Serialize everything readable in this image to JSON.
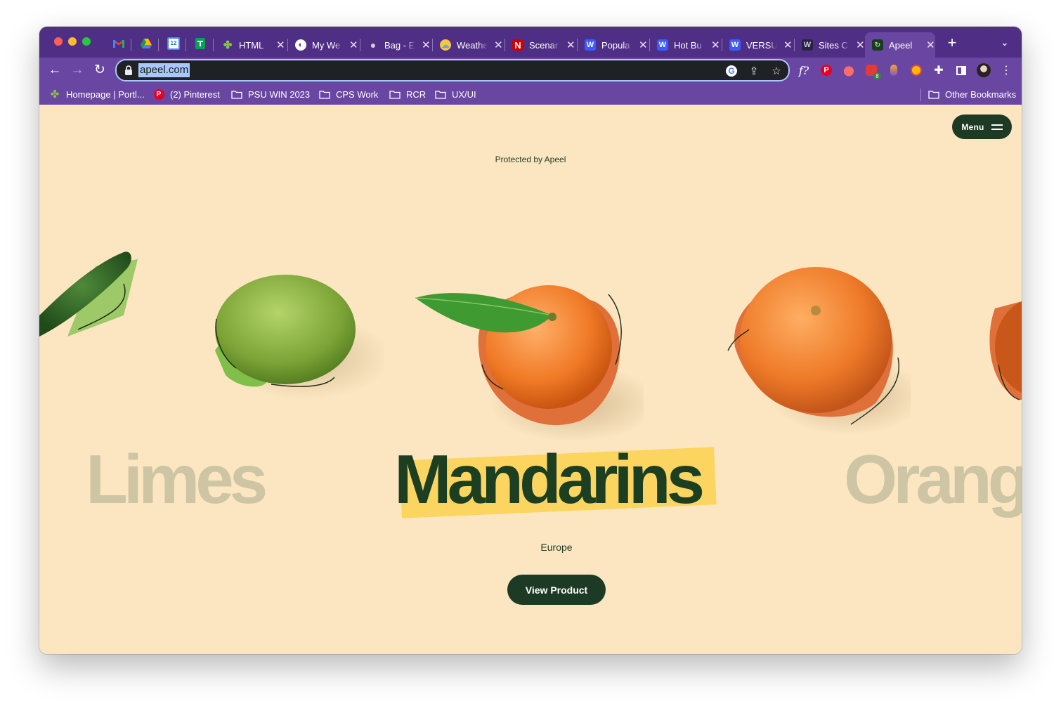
{
  "browser": {
    "tabs": [
      {
        "title": "HTML",
        "favicon": "figma-like-icon"
      },
      {
        "title": "My We",
        "favicon": "globe-icon"
      },
      {
        "title": "Bag - E",
        "favicon": "apple-icon"
      },
      {
        "title": "Weathe",
        "favicon": "weather-icon"
      },
      {
        "title": "Scenar",
        "favicon": "n-logo-icon"
      },
      {
        "title": "Popula",
        "favicon": "w-logo-icon"
      },
      {
        "title": "Hot Bu",
        "favicon": "w-logo-icon"
      },
      {
        "title": "VERSU",
        "favicon": "w-logo-icon"
      },
      {
        "title": "Sites C",
        "favicon": "w-dark-logo-icon"
      },
      {
        "title": "Apeel",
        "favicon": "apeel-icon",
        "active": true
      }
    ],
    "pinned": [
      "gmail-icon",
      "drive-icon",
      "calendar-icon",
      "sheets-icon"
    ],
    "address": "apeel.com",
    "bookmarks": [
      {
        "label": "Homepage | Portl...",
        "icon": "clover-icon"
      },
      {
        "label": "(2) Pinterest",
        "icon": "pinterest-icon"
      },
      {
        "label": "PSU WIN 2023",
        "icon": "folder-icon"
      },
      {
        "label": "CPS Work",
        "icon": "folder-icon"
      },
      {
        "label": "RCR",
        "icon": "folder-icon"
      },
      {
        "label": "UX/UI",
        "icon": "folder-icon"
      }
    ],
    "other_bookmarks": "Other Bookmarks",
    "badge_count": "8"
  },
  "page": {
    "menu_label": "Menu",
    "protected_label": "Protected by Apeel",
    "produce_left": "Limes",
    "produce_current": "Mandarins",
    "produce_right": "Orang",
    "region": "Europe",
    "cta_label": "View Product"
  },
  "colors": {
    "tab_strip": "#4f2f86",
    "toolbar": "#6a46a3",
    "page_background": "#fbe6c1",
    "brand_dark_green": "#1d3b24",
    "highlight_yellow": "#fbd55f",
    "faded_text": "#cdc5a3"
  }
}
